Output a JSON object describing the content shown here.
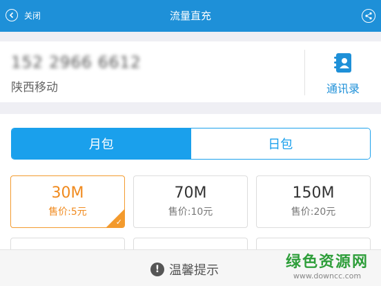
{
  "header": {
    "back_label": "关闭",
    "title": "流量直充",
    "back_icon": "back-arrow-icon",
    "share_icon": "share-icon",
    "color": "#1e90d8"
  },
  "account": {
    "phone_number": "152 2966 6612",
    "carrier": "陕西移动",
    "contacts_label": "通讯录",
    "contacts_icon": "address-book-icon"
  },
  "tabs": [
    {
      "label": "月包",
      "active": true
    },
    {
      "label": "日包",
      "active": false
    }
  ],
  "packages": [
    {
      "size": "30M",
      "price": "售价:5元",
      "selected": true
    },
    {
      "size": "70M",
      "price": "售价:10元",
      "selected": false
    },
    {
      "size": "150M",
      "price": "售价:20元",
      "selected": false
    }
  ],
  "footer": {
    "tip_label": "温馨提示",
    "tip_icon": "warning-icon"
  },
  "watermark": {
    "line1": "绿色资源网",
    "line2": "www.downcc.com"
  },
  "colors": {
    "accent": "#1aa0ec",
    "selected": "#f39a2d"
  }
}
